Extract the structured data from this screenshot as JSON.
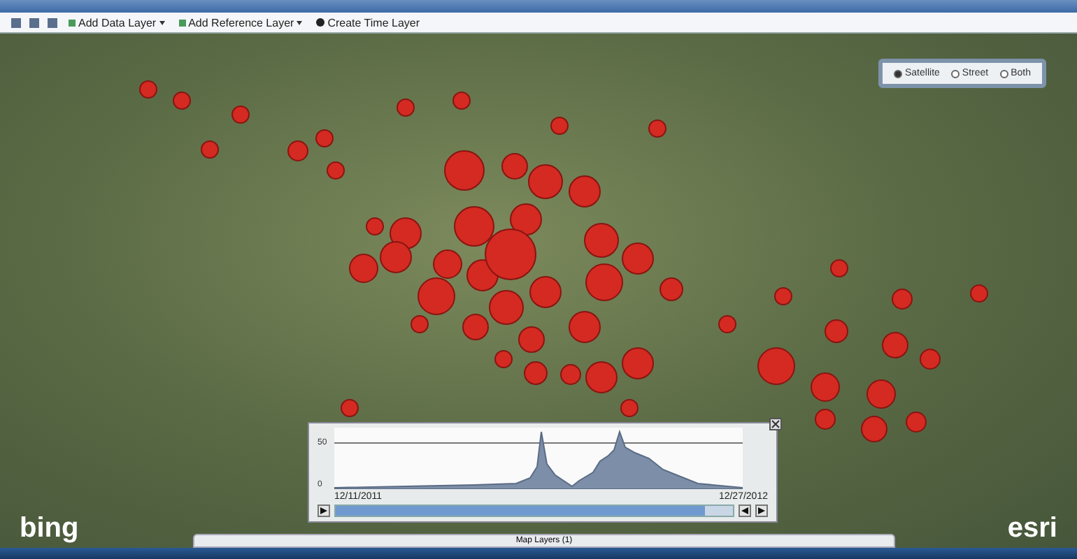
{
  "toolbar": {
    "items": [
      {
        "label": "Add Data Layer",
        "kind": "dropdown"
      },
      {
        "label": "Add Reference Layer",
        "kind": "dropdown"
      },
      {
        "label": "Create Time Layer",
        "kind": "button"
      }
    ]
  },
  "basemap_switcher": {
    "options": [
      {
        "label": "Satellite",
        "selected": true
      },
      {
        "label": "Street",
        "selected": false
      },
      {
        "label": "Both",
        "selected": false
      }
    ]
  },
  "time_slider": {
    "y_max_label": "50",
    "y_min_label": "0",
    "start_date": "12/11/2011",
    "end_date": "12/27/2012",
    "level": 0.93
  },
  "map_layers_tab": {
    "label": "Map Layers (1)"
  },
  "logos": {
    "left": "bing",
    "right": "esri"
  }
}
